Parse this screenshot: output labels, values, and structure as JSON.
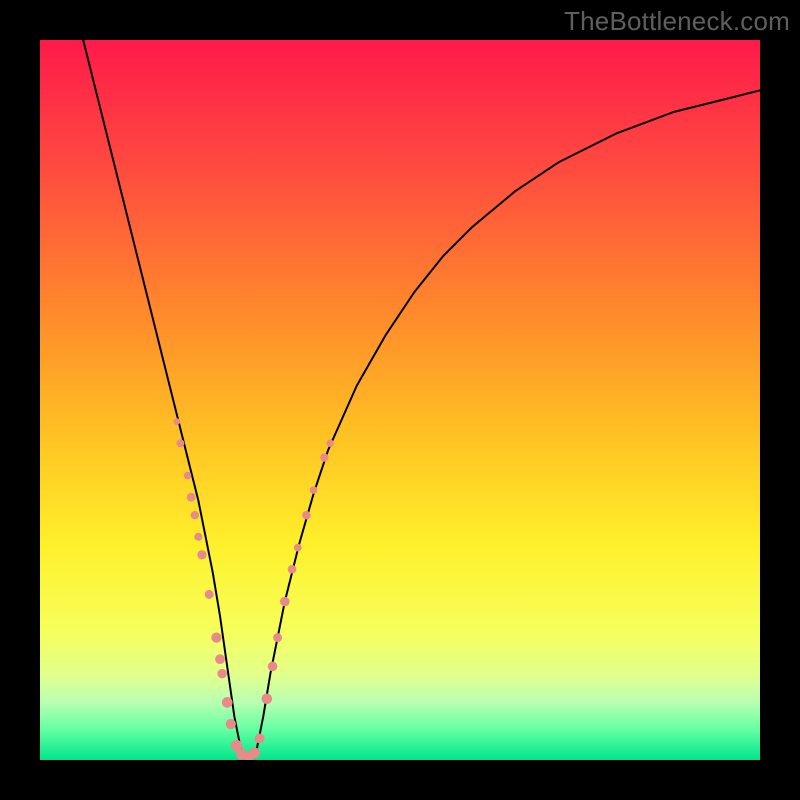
{
  "watermark": "TheBottleneck.com",
  "chart_data": {
    "type": "line",
    "title": "",
    "xlabel": "",
    "ylabel": "",
    "xlim": [
      0,
      100
    ],
    "ylim": [
      0,
      100
    ],
    "background": {
      "type": "vertical-gradient",
      "stops": [
        {
          "pct": 0,
          "color": "#ff1a4b"
        },
        {
          "pct": 18,
          "color": "#ff4b3f"
        },
        {
          "pct": 38,
          "color": "#ff8a2b"
        },
        {
          "pct": 55,
          "color": "#ffc223"
        },
        {
          "pct": 70,
          "color": "#fff02a"
        },
        {
          "pct": 82,
          "color": "#f6ff5b"
        },
        {
          "pct": 88,
          "color": "#e3ff8a"
        },
        {
          "pct": 92,
          "color": "#b8ffb3"
        },
        {
          "pct": 96,
          "color": "#5effa0"
        },
        {
          "pct": 100,
          "color": "#00e58c"
        }
      ]
    },
    "series": [
      {
        "name": "curve",
        "color": "#000000",
        "stroke_width": 2,
        "x": [
          6,
          8,
          10,
          12,
          14,
          16,
          18,
          20,
          21,
          22,
          23,
          24,
          25,
          26,
          27,
          28,
          29,
          30,
          31,
          32,
          34,
          36,
          38,
          40,
          44,
          48,
          52,
          56,
          60,
          66,
          72,
          80,
          88,
          96,
          100
        ],
        "y": [
          100,
          92,
          84,
          76,
          68,
          60,
          52,
          44,
          40,
          36,
          31,
          26,
          20,
          13,
          6,
          1,
          0,
          1,
          6,
          12,
          22,
          30,
          37,
          43,
          52,
          59,
          65,
          70,
          74,
          79,
          83,
          87,
          90,
          92,
          93
        ]
      }
    ],
    "markers": {
      "name": "segment-markers",
      "color": "#e98a8a",
      "radius_range": [
        3.0,
        5.5
      ],
      "points": [
        {
          "x": 19.0,
          "y": 47.0
        },
        {
          "x": 19.5,
          "y": 44.0
        },
        {
          "x": 20.5,
          "y": 39.5
        },
        {
          "x": 21.0,
          "y": 36.5
        },
        {
          "x": 21.5,
          "y": 34.0
        },
        {
          "x": 22.0,
          "y": 31.0
        },
        {
          "x": 22.5,
          "y": 28.5
        },
        {
          "x": 23.5,
          "y": 23.0
        },
        {
          "x": 24.5,
          "y": 17.0
        },
        {
          "x": 25.0,
          "y": 14.0
        },
        {
          "x": 25.3,
          "y": 12.0
        },
        {
          "x": 26.0,
          "y": 8.0
        },
        {
          "x": 26.5,
          "y": 5.0
        },
        {
          "x": 27.3,
          "y": 2.0
        },
        {
          "x": 28.0,
          "y": 0.8
        },
        {
          "x": 29.0,
          "y": 0.5
        },
        {
          "x": 29.8,
          "y": 1.0
        },
        {
          "x": 30.5,
          "y": 3.0
        },
        {
          "x": 31.5,
          "y": 8.5
        },
        {
          "x": 32.3,
          "y": 13.0
        },
        {
          "x": 33.0,
          "y": 17.0
        },
        {
          "x": 34.0,
          "y": 22.0
        },
        {
          "x": 35.0,
          "y": 26.5
        },
        {
          "x": 35.8,
          "y": 29.5
        },
        {
          "x": 37.0,
          "y": 34.0
        },
        {
          "x": 38.0,
          "y": 37.5
        },
        {
          "x": 39.5,
          "y": 42.0
        },
        {
          "x": 40.3,
          "y": 44.0
        }
      ]
    }
  }
}
